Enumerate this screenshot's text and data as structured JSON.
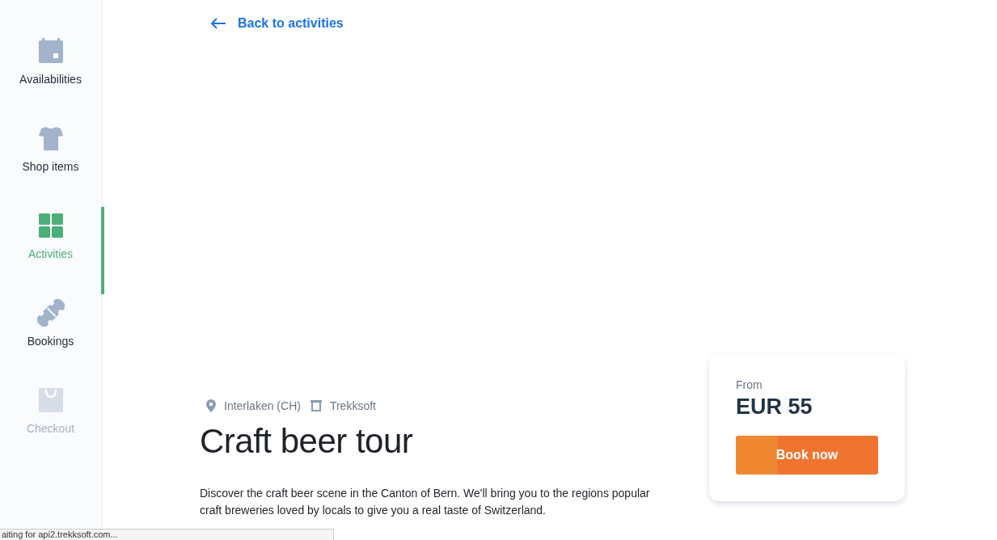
{
  "sidebar": {
    "items": [
      {
        "label": "Availabilities",
        "kind": "calendar",
        "selected": false,
        "disabled": false
      },
      {
        "label": "Shop items",
        "kind": "shirt",
        "selected": false,
        "disabled": false
      },
      {
        "label": "Activities",
        "kind": "grid",
        "selected": true,
        "disabled": false
      },
      {
        "label": "Bookings",
        "kind": "ticket",
        "selected": false,
        "disabled": false
      },
      {
        "label": "Checkout",
        "kind": "bag",
        "selected": false,
        "disabled": true
      }
    ]
  },
  "back_link": "Back to activities",
  "meta": [
    {
      "kind": "location",
      "text": "Interlaken (CH)"
    },
    {
      "kind": "operator",
      "text": "Trekksoft"
    }
  ],
  "title": "Craft beer tour",
  "description": "Discover the craft beer scene in the Canton of Bern. We'll bring you to the regions popular craft breweries loved by locals to give you a real taste of Switzerland.",
  "price_card": {
    "label": "From",
    "price": "EUR 55",
    "button": "Book now"
  },
  "status_bar": "aiting for api2.trekksoft.com..."
}
